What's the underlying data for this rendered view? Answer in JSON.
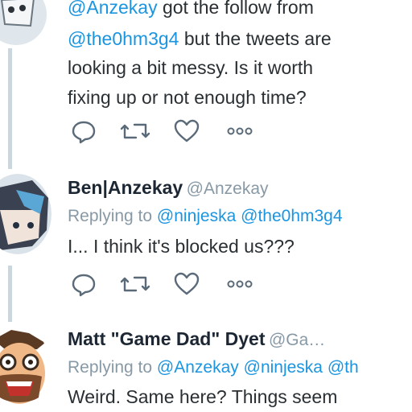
{
  "tweets": [
    {
      "body": {
        "mention1": "@Anzekay",
        "text1": " got the follow from",
        "mention2": "@the0hm3g4",
        "text2": " but the tweets are",
        "line3": "looking a bit messy. Is it worth",
        "line4": "fixing up or not enough time?"
      }
    },
    {
      "name": "Ben|Anzekay",
      "handle": "@Anzekay",
      "replying_prefix": "Replying to",
      "replying_to": [
        "@ninjeska",
        "@the0hm3g4"
      ],
      "body": "I... I think it's blocked us???"
    },
    {
      "name": "Matt \"Game Dad\" Dyet",
      "handle": "@Ga…",
      "replying_prefix": "Replying to",
      "replying_to": [
        "@Anzekay",
        "@ninjeska",
        "@th"
      ],
      "body": "Weird. Same here? Things seem"
    }
  ],
  "icons": [
    "reply-icon",
    "retweet-icon",
    "like-icon",
    "more-icon"
  ],
  "colors": {
    "link": "#1b95e0",
    "muted": "#8899a6",
    "thread_line": "#ccd6dd"
  }
}
